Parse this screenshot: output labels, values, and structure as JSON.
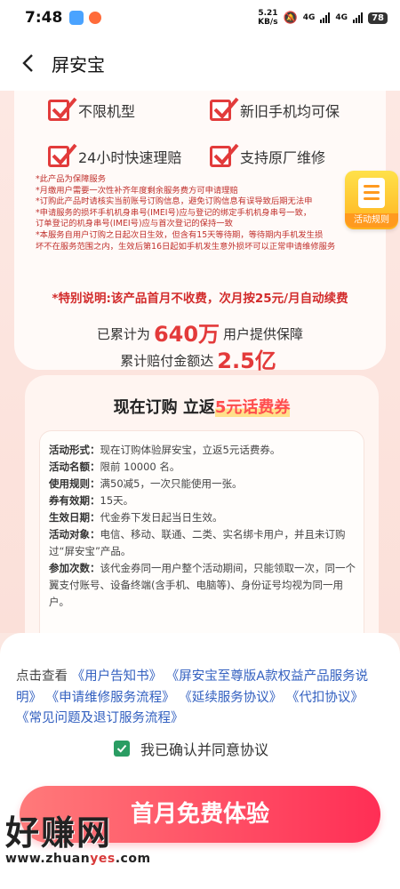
{
  "status_bar": {
    "time": "7:48",
    "speed_value": "5.21",
    "speed_unit": "KB/s",
    "network1": "4G",
    "network2": "4G",
    "battery": "78"
  },
  "nav": {
    "title": "屏安宝"
  },
  "features": [
    {
      "label": "不限机型"
    },
    {
      "label": "新旧手机均可保"
    },
    {
      "label": "24小时快速理赔"
    },
    {
      "label": "支持原厂维修"
    }
  ],
  "notes": [
    "*此产品为保障服务",
    "*月缴用户需要一次性补齐年度剩余服务费方可申请理赔",
    "*订购此产品时请核实当前账号订购信息，避免订购信息有误导致后期无法申",
    "*申请服务的损坏手机机身串号(IMEI号)应与登记的绑定手机机身串号一致，",
    "  订单登记的机身串号(IMEI号)应与首次登记的保持一致",
    "*本服务自用户订购之日起次日生效，但含有15天等待期，等待期内手机发生损",
    "  坏不在服务范围之内，生效后第16日起如手机发生意外损坏可以正常申请维修服务"
  ],
  "float_badge": {
    "label": "活动规则"
  },
  "special_note": "*特别说明:该产品首月不收费，次月按25元/月自动续费",
  "stats": {
    "users_prefix": "已累计为",
    "users_value": "640万",
    "users_suffix": "用户提供保障",
    "claims_prefix": "累计赔付金额达",
    "claims_value": "2.5亿"
  },
  "promo": {
    "title_prefix": "现在订购 立返",
    "title_highlight": "5元话费券",
    "rules": [
      {
        "label": "活动形式：",
        "text": "现在订购体验屏安宝，立返5元话费券。"
      },
      {
        "label": "活动名额：",
        "text": "限前 10000 名。"
      },
      {
        "label": "使用规则：",
        "text": "满50减5，一次只能使用一张。"
      },
      {
        "label": "券有效期：",
        "text": "15天。"
      },
      {
        "label": "生效日期：",
        "text": "代金券下发日起当日生效。"
      },
      {
        "label": "活动对象：",
        "text": "电信、移动、联通、二类、实名绑卡用户，并且未订购过“屏安宝”产品。"
      },
      {
        "label": "参加次数：",
        "text": "该代金券同一用户整个活动期间，只能领取一次，同一个翼支付账号、设备终端(含手机、电脑等)、身份证号均视为同一用户。"
      }
    ]
  },
  "agreement": {
    "prefix": "点击查看",
    "links": [
      "《用户告知书》",
      "《屏安宝至尊版A款权益产品服务说明》",
      "《申请维修服务流程》",
      "《延续服务协议》",
      "《代扣协议》",
      "《常见问题及退订服务流程》"
    ],
    "confirm_label": "我已确认并同意协议",
    "confirm_checked": true
  },
  "cta": {
    "label": "首月免费体验"
  },
  "watermark": {
    "text": "好赚网",
    "url_part1": "www.zhuan",
    "url_part2": "yes",
    "url_part3": ".com"
  },
  "colors": {
    "accent": "#ff2e55",
    "check": "#2a9d63",
    "link": "#3360c0",
    "warning": "#d22b2b"
  }
}
